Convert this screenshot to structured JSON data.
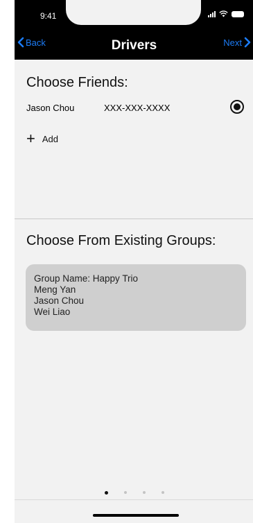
{
  "status_bar": {
    "time": "9:41"
  },
  "nav": {
    "back_label": "Back",
    "title": "Drivers",
    "next_label": "Next"
  },
  "friends": {
    "title": "Choose Friends:",
    "items": [
      {
        "name": "Jason Chou",
        "phone": "XXX-XXX-XXXX",
        "selected": true
      }
    ],
    "add_label": "Add"
  },
  "groups": {
    "title": "Choose From Existing Groups:",
    "items": [
      {
        "name_line": "Group Name: Happy Trio",
        "members": [
          "Meng Yan",
          "Jason Chou",
          "Wei Liao"
        ]
      }
    ]
  },
  "pagination": {
    "total": 4,
    "current": 1
  },
  "colors": {
    "accent": "#1c7cf7",
    "nav_background": "#000000",
    "page_background": "#f2f2f2",
    "card_background": "#cfcfcf"
  }
}
